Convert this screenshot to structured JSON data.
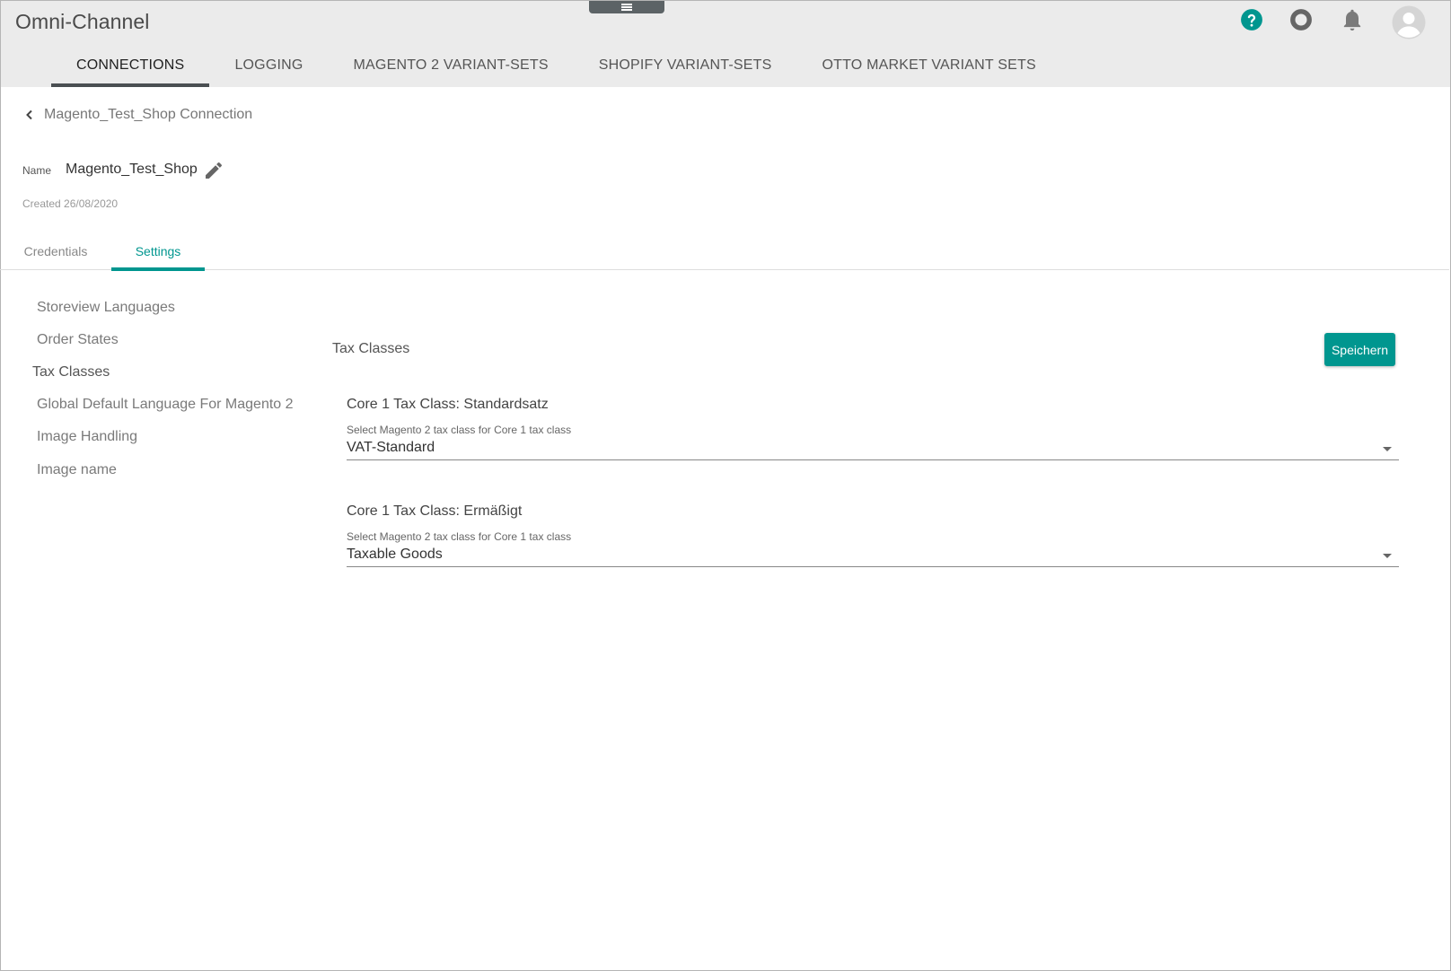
{
  "app": {
    "title": "Omni-Channel"
  },
  "header_icons": {
    "help": "help-icon",
    "status": "status-ring-icon",
    "notifications": "bell-icon",
    "user": "avatar"
  },
  "nav": {
    "tabs": [
      {
        "label": "CONNECTIONS",
        "active": true
      },
      {
        "label": "LOGGING",
        "active": false
      },
      {
        "label": "MAGENTO 2 VARIANT-SETS",
        "active": false
      },
      {
        "label": "SHOPIFY VARIANT-SETS",
        "active": false
      },
      {
        "label": "OTTO MARKET VARIANT SETS",
        "active": false
      }
    ]
  },
  "breadcrumb": {
    "title": "Magento_Test_Shop Connection"
  },
  "connection": {
    "name_label": "Name",
    "name_value": "Magento_Test_Shop",
    "created": "Created 26/08/2020"
  },
  "sub_tabs": [
    {
      "label": "Credentials",
      "active": false
    },
    {
      "label": "Settings",
      "active": true
    }
  ],
  "side_menu": [
    {
      "label": "Storeview Languages",
      "active": false
    },
    {
      "label": "Order States",
      "active": false
    },
    {
      "label": "Tax Classes",
      "active": true
    },
    {
      "label": "Global Default Language For Magento 2",
      "active": false
    },
    {
      "label": "Image Handling",
      "active": false
    },
    {
      "label": "Image name",
      "active": false
    }
  ],
  "panel": {
    "title": "Tax Classes",
    "save_label": "Speichern",
    "tax_classes": [
      {
        "heading": "Core 1 Tax Class: Standardsatz",
        "field_label": "Select Magento 2 tax class for Core 1 tax class",
        "value": "VAT-Standard"
      },
      {
        "heading": "Core 1 Tax Class: Ermäßigt",
        "field_label": "Select Magento 2 tax class for Core 1 tax class",
        "value": "Taxable Goods"
      }
    ]
  },
  "colors": {
    "accent": "#00968f",
    "header_bg": "#ebebeb",
    "active_nav_underline": "#4a4f52"
  }
}
